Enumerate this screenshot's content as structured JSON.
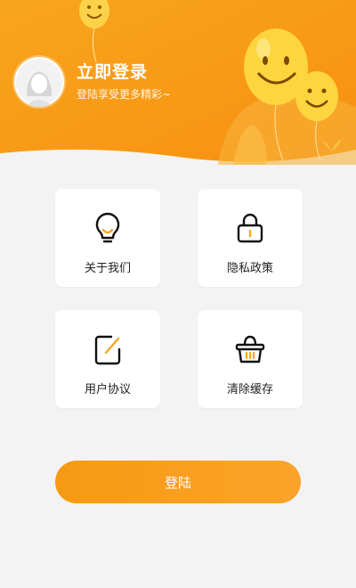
{
  "header": {
    "title": "立即登录",
    "subtitle": "登陆享受更多精彩~"
  },
  "menu": [
    {
      "label": "关于我们",
      "icon": "lightbulb-icon"
    },
    {
      "label": "隐私政策",
      "icon": "lock-icon"
    },
    {
      "label": "用户协议",
      "icon": "edit-icon"
    },
    {
      "label": "清除缓存",
      "icon": "basket-icon"
    }
  ],
  "login_button": {
    "label": "登陆"
  },
  "colors": {
    "accent": "#f9a21f",
    "background": "#f3f3f3"
  }
}
